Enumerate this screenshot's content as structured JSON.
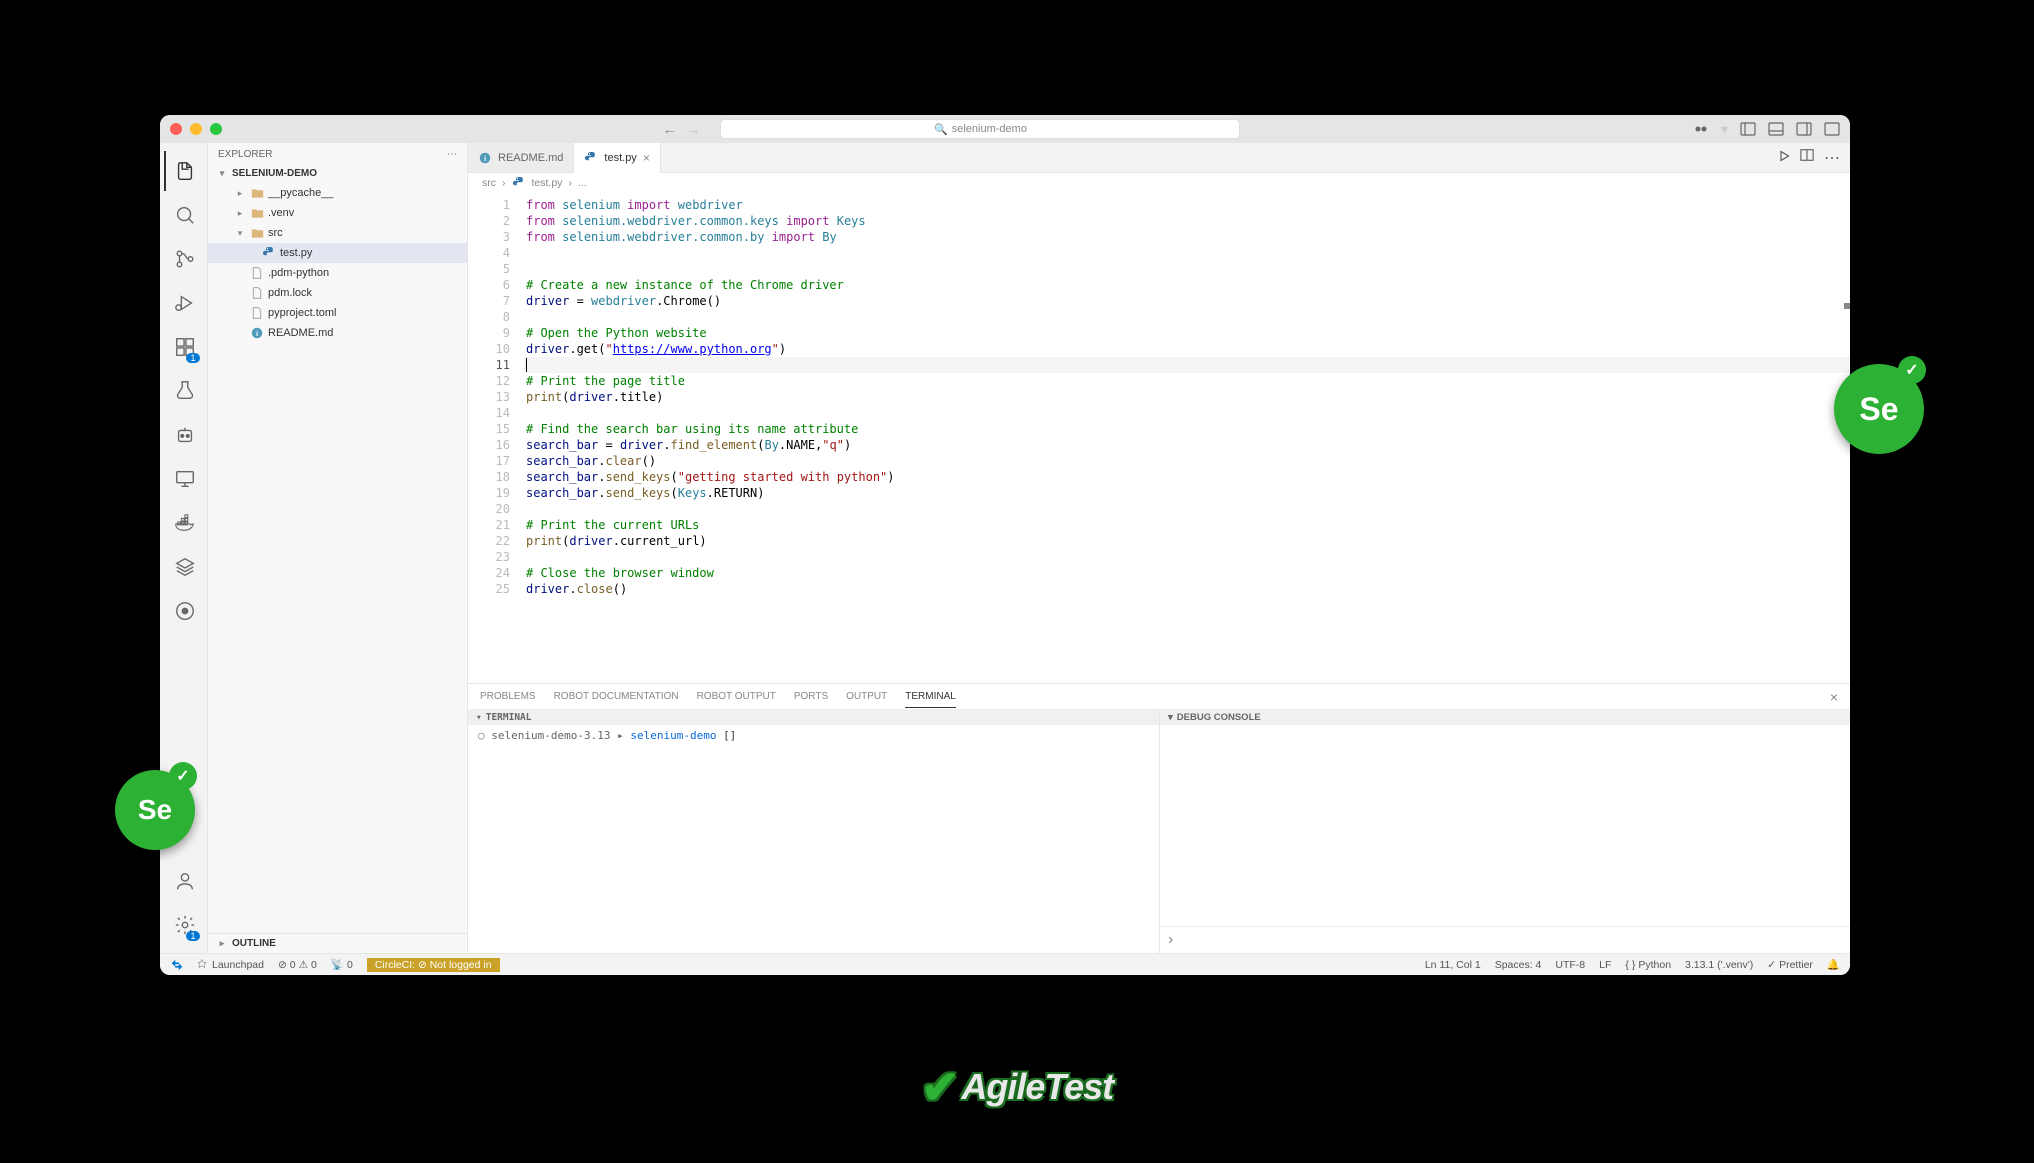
{
  "titlebar": {
    "search_placeholder": "selenium-demo"
  },
  "sidebar": {
    "title": "EXPLORER",
    "project": "SELENIUM-DEMO",
    "tree": [
      {
        "name": "__pycache__",
        "type": "folder",
        "depth": 1,
        "expanded": false
      },
      {
        "name": ".venv",
        "type": "folder",
        "depth": 1,
        "expanded": false
      },
      {
        "name": "src",
        "type": "folder",
        "depth": 1,
        "expanded": true
      },
      {
        "name": "test.py",
        "type": "py",
        "depth": 2,
        "active": true
      },
      {
        "name": ".pdm-python",
        "type": "file",
        "depth": 1
      },
      {
        "name": "pdm.lock",
        "type": "file",
        "depth": 1
      },
      {
        "name": "pyproject.toml",
        "type": "file",
        "depth": 1
      },
      {
        "name": "README.md",
        "type": "md",
        "depth": 1
      }
    ],
    "outline": "OUTLINE"
  },
  "tabs": [
    {
      "name": "README.md",
      "icon": "md",
      "active": false
    },
    {
      "name": "test.py",
      "icon": "py",
      "active": true
    }
  ],
  "breadcrumb": [
    "src",
    "test.py",
    "..."
  ],
  "code": {
    "current_line": 11,
    "lines": [
      {
        "n": 1,
        "t": [
          [
            "kw",
            "from"
          ],
          [
            "",
            " "
          ],
          [
            "mod",
            "selenium"
          ],
          [
            "",
            " "
          ],
          [
            "kw",
            "import"
          ],
          [
            "",
            " "
          ],
          [
            "mod",
            "webdriver"
          ]
        ]
      },
      {
        "n": 2,
        "t": [
          [
            "kw",
            "from"
          ],
          [
            "",
            " "
          ],
          [
            "mod",
            "selenium.webdriver.common.keys"
          ],
          [
            "",
            " "
          ],
          [
            "kw",
            "import"
          ],
          [
            "",
            " "
          ],
          [
            "mod",
            "Keys"
          ]
        ]
      },
      {
        "n": 3,
        "t": [
          [
            "kw",
            "from"
          ],
          [
            "",
            " "
          ],
          [
            "mod",
            "selenium.webdriver.common.by"
          ],
          [
            "",
            " "
          ],
          [
            "kw",
            "import"
          ],
          [
            "",
            " "
          ],
          [
            "mod",
            "By"
          ]
        ]
      },
      {
        "n": 4,
        "t": []
      },
      {
        "n": 5,
        "t": []
      },
      {
        "n": 6,
        "t": [
          [
            "cmt",
            "# Create a new instance of the Chrome driver"
          ]
        ]
      },
      {
        "n": 7,
        "t": [
          [
            "var",
            "driver"
          ],
          [
            "",
            " = "
          ],
          [
            "mod",
            "webdriver"
          ],
          [
            "",
            ".Chrome()"
          ]
        ]
      },
      {
        "n": 8,
        "t": []
      },
      {
        "n": 9,
        "t": [
          [
            "cmt",
            "# Open the Python website"
          ]
        ]
      },
      {
        "n": 10,
        "t": [
          [
            "var",
            "driver"
          ],
          [
            "",
            ".get("
          ],
          [
            "str",
            "\""
          ],
          [
            "url",
            "https://www.python.org"
          ],
          [
            "str",
            "\""
          ],
          [
            "",
            ")"
          ]
        ]
      },
      {
        "n": 11,
        "t": [],
        "cursor": true,
        "hl": true
      },
      {
        "n": 12,
        "t": [
          [
            "cmt",
            "# Print the page title"
          ]
        ]
      },
      {
        "n": 13,
        "t": [
          [
            "fn",
            "print"
          ],
          [
            "",
            "("
          ],
          [
            "var",
            "driver"
          ],
          [
            "",
            ".title)"
          ]
        ]
      },
      {
        "n": 14,
        "t": []
      },
      {
        "n": 15,
        "t": [
          [
            "cmt",
            "# Find the search bar using its name attribute"
          ]
        ]
      },
      {
        "n": 16,
        "t": [
          [
            "var",
            "search_bar"
          ],
          [
            "",
            " = "
          ],
          [
            "var",
            "driver"
          ],
          [
            "",
            "."
          ],
          [
            "fn",
            "find_element"
          ],
          [
            "",
            "("
          ],
          [
            "mod",
            "By"
          ],
          [
            "",
            ".NAME,"
          ],
          [
            "str",
            "\"q\""
          ],
          [
            "",
            ")"
          ]
        ]
      },
      {
        "n": 17,
        "t": [
          [
            "var",
            "search_bar"
          ],
          [
            "",
            "."
          ],
          [
            "fn",
            "clear"
          ],
          [
            "",
            "()"
          ]
        ]
      },
      {
        "n": 18,
        "t": [
          [
            "var",
            "search_bar"
          ],
          [
            "",
            "."
          ],
          [
            "fn",
            "send_keys"
          ],
          [
            "",
            "("
          ],
          [
            "str",
            "\"getting started with python\""
          ],
          [
            "",
            ")"
          ]
        ]
      },
      {
        "n": 19,
        "t": [
          [
            "var",
            "search_bar"
          ],
          [
            "",
            "."
          ],
          [
            "fn",
            "send_keys"
          ],
          [
            "",
            "("
          ],
          [
            "mod",
            "Keys"
          ],
          [
            "",
            ".RETURN)"
          ]
        ]
      },
      {
        "n": 20,
        "t": []
      },
      {
        "n": 21,
        "t": [
          [
            "cmt",
            "# Print the current URLs"
          ]
        ]
      },
      {
        "n": 22,
        "t": [
          [
            "fn",
            "print"
          ],
          [
            "",
            "("
          ],
          [
            "var",
            "driver"
          ],
          [
            "",
            ".current_url)"
          ]
        ]
      },
      {
        "n": 23,
        "t": []
      },
      {
        "n": 24,
        "t": [
          [
            "cmt",
            "# Close the browser window"
          ]
        ]
      },
      {
        "n": 25,
        "t": [
          [
            "var",
            "driver"
          ],
          [
            "",
            "."
          ],
          [
            "fn",
            "close"
          ],
          [
            "",
            "()"
          ]
        ]
      }
    ]
  },
  "panel": {
    "tabs": [
      "PROBLEMS",
      "ROBOT DOCUMENTATION",
      "ROBOT OUTPUT",
      "PORTS",
      "OUTPUT",
      "TERMINAL"
    ],
    "active_tab": "TERMINAL",
    "terminal_label": "TERMINAL",
    "debug_label": "DEBUG CONSOLE",
    "prompt_env": "selenium-demo-3.13",
    "prompt_repo": "selenium-demo",
    "prompt_cursor": "[]"
  },
  "status": {
    "remote": "",
    "launchpad": "Launchpad",
    "errors": "0",
    "warnings": "0",
    "ports": "0",
    "circleci": "CircleCI: ⊘ Not logged in",
    "cursor": "Ln 11, Col 1",
    "spaces": "Spaces: 4",
    "encoding": "UTF-8",
    "eol": "LF",
    "lang": "Python",
    "interpreter": "3.13.1 ('.venv')",
    "prettier": "Prettier"
  },
  "logos": {
    "selenium": "Se",
    "agiletest": "AgileTest"
  }
}
